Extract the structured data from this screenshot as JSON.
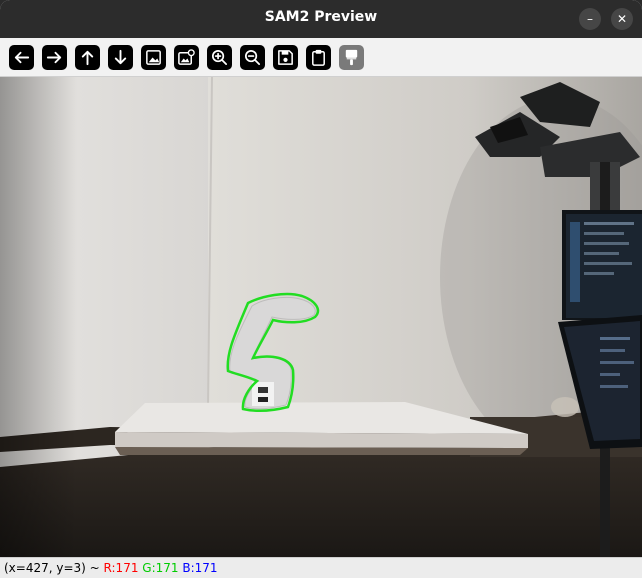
{
  "window": {
    "title": "SAM2 Preview",
    "minimize_label": "–",
    "close_label": "✕"
  },
  "toolbar": {
    "buttons": [
      {
        "name": "back-icon",
        "enabled": true
      },
      {
        "name": "forward-icon",
        "enabled": true
      },
      {
        "name": "up-icon",
        "enabled": true
      },
      {
        "name": "down-icon",
        "enabled": true
      },
      {
        "name": "image-icon",
        "enabled": true
      },
      {
        "name": "image-settings-icon",
        "enabled": true
      },
      {
        "name": "zoom-in-icon",
        "enabled": true
      },
      {
        "name": "zoom-out-icon",
        "enabled": true
      },
      {
        "name": "save-icon",
        "enabled": true
      },
      {
        "name": "clipboard-icon",
        "enabled": true
      },
      {
        "name": "paint-brush-icon",
        "enabled": false
      }
    ]
  },
  "viewer": {
    "mask_color": "#22dd22"
  },
  "status": {
    "coords": "(x=427, y=3) ~",
    "r_label": "R:171",
    "g_label": "G:171",
    "b_label": "B:171",
    "r_color": "#ff0000",
    "g_color": "#00cc00",
    "b_color": "#0000ff"
  }
}
